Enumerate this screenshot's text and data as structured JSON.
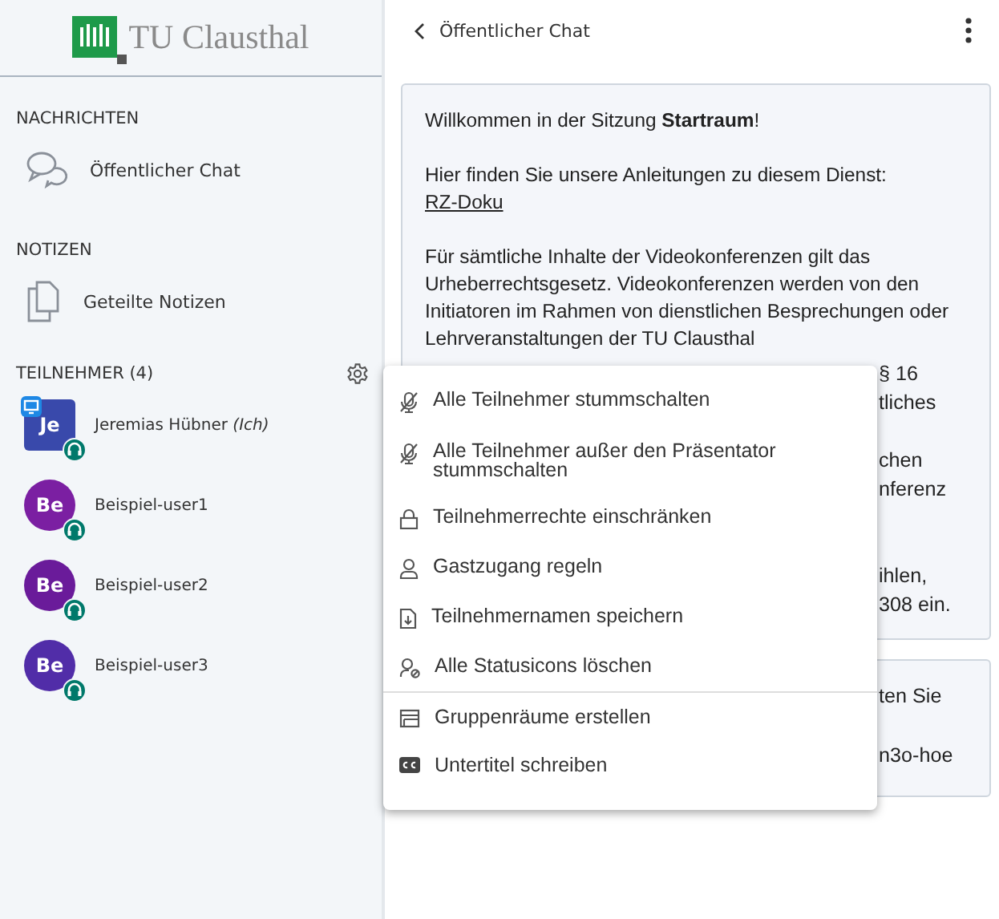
{
  "logo": {
    "text": "TU Clausthal"
  },
  "sidebar": {
    "messages_heading": "NACHRICHTEN",
    "messages": [
      {
        "label": "Öffentlicher Chat",
        "kind": "chat"
      }
    ],
    "notes_heading": "NOTIZEN",
    "notes": [
      {
        "label": "Geteilte Notizen",
        "kind": "notes"
      }
    ],
    "participants_heading": "TEILNEHMER (4)",
    "participants": [
      {
        "initials": "Je",
        "name": "Jeremias Hübner *(Ich)*",
        "presenter": true,
        "color": "#3949ab"
      },
      {
        "initials": "Be",
        "name": "Beispiel-user1",
        "presenter": false,
        "color": "#7b1fa2"
      },
      {
        "initials": "Be",
        "name": "Beispiel-user2",
        "presenter": false,
        "color": "#6a1b9a"
      },
      {
        "initials": "Be",
        "name": "Beispiel-user3",
        "presenter": false,
        "color": "#512da8"
      }
    ]
  },
  "chat": {
    "title": "Öffentlicher Chat",
    "welcome": {
      "line_1": "Willkommen in der Sitzung **Startraum**!",
      "line_2": "Hier finden Sie unsere Anleitungen zu diesem Dienst:",
      "link": "RZ-Doku",
      "paragraph": "Für sämtliche Inhalte der Videokonferenzen gilt das Urheberrechtsgesetz. Videokonferenzen werden von den Initiatoren im Rahmen von dienstlichen Besprechungen oder Lehrveranstaltungen der TU Clausthal",
      "fragments": [
        "§ 16",
        "tliches",
        "chen",
        "nferenz",
        "ihlen,",
        "308 ein."
      ]
    },
    "second_message_fragments": [
      "ten Sie",
      "n3o-hoe"
    ]
  },
  "menu": [
    {
      "label": "Alle Teilnehmer stummschalten",
      "kind": "mic-off",
      "divider_before": false
    },
    {
      "label": "Alle Teilnehmer außer den Präsentator stummschalten",
      "kind": "mic-off",
      "divider_before": false
    },
    {
      "label": "Teilnehmerrechte einschränken",
      "kind": "lock",
      "divider_before": false
    },
    {
      "label": "Gastzugang regeln",
      "kind": "user",
      "divider_before": false
    },
    {
      "label": "Teilnehmernamen speichern",
      "kind": "download",
      "divider_before": false
    },
    {
      "label": "Alle Statusicons löschen",
      "kind": "clear-status",
      "divider_before": false
    },
    {
      "label": "Gruppenräume erstellen",
      "kind": "rooms",
      "divider_before": true
    },
    {
      "label": "Untertitel schreiben",
      "kind": "cc",
      "divider_before": false
    }
  ]
}
